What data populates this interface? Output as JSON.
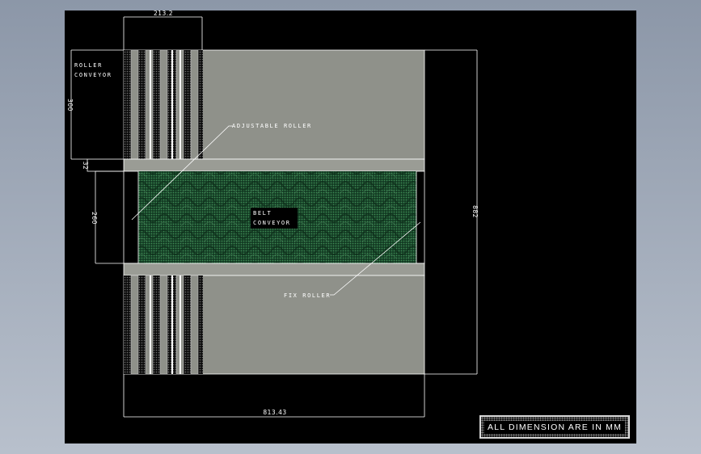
{
  "labels": {
    "roller_conveyor_line1": "ROLLER",
    "roller_conveyor_line2": "CONVEYOR",
    "adjustable_roller": "ADJUSTABLE ROLLER",
    "belt_conveyor_line1": "BELT",
    "belt_conveyor_line2": "CONVEYOR",
    "fix_roller": "FIX ROLLER"
  },
  "dimensions": {
    "roller_width": "213.2",
    "roller_height": "300",
    "gap": "32",
    "belt_height": "260",
    "overall_height": "882",
    "overall_width": "813.43"
  },
  "note": "ALL DIMENSION ARE IN MM",
  "colors": {
    "background": "#000000",
    "frame": "#8f918a",
    "belt": "#1e5a34",
    "lines": "#ffffff"
  }
}
